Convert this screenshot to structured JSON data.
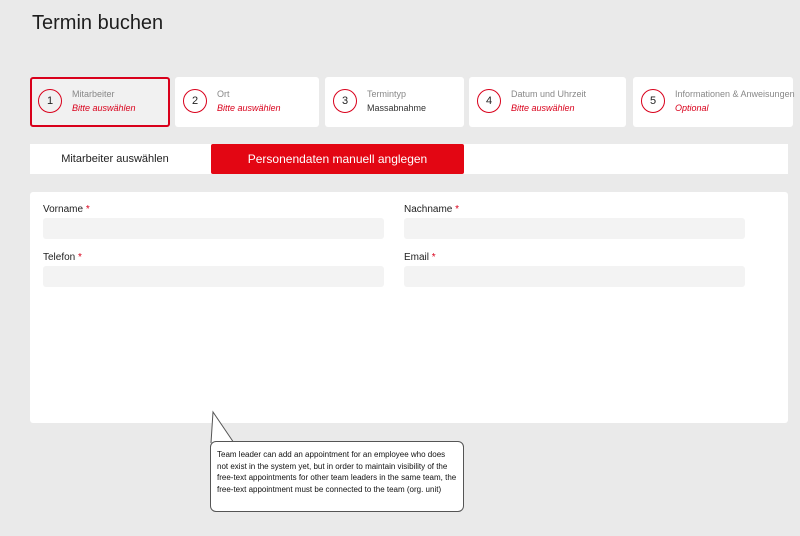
{
  "page": {
    "title": "Termin buchen"
  },
  "steps": [
    {
      "number": "1",
      "label": "Mitarbeiter",
      "value": "Bitte auswählen"
    },
    {
      "number": "2",
      "label": "Ort",
      "value": "Bitte auswählen"
    },
    {
      "number": "3",
      "label": "Termintyp",
      "value": "Massabnahme"
    },
    {
      "number": "4",
      "label": "Datum und Uhrzeit",
      "value": "Bitte auswählen"
    },
    {
      "number": "5",
      "label": "Informationen & Anweisungen",
      "value": "Optional"
    }
  ],
  "tabs": {
    "select_employee": "Mitarbeiter auswählen",
    "manual_entry": "Personendaten manuell anglegen"
  },
  "form": {
    "required_marker": "*",
    "first_name": {
      "label": "Vorname",
      "value": ""
    },
    "last_name": {
      "label": "Nachname",
      "value": ""
    },
    "phone": {
      "label": "Telefon",
      "value": ""
    },
    "email": {
      "label": "Email",
      "value": ""
    }
  },
  "note": {
    "text": "Team leader can add an appointment for an employee who does not exist in the system yet, but in order to maintain visibility of the free-text appointments for other team leaders in the same team, the free-text appointment must be connected to the team (org. unit)"
  },
  "colors": {
    "accent": "#e30613",
    "background": "#eaeaea",
    "input_bg": "#f3f3f3"
  }
}
